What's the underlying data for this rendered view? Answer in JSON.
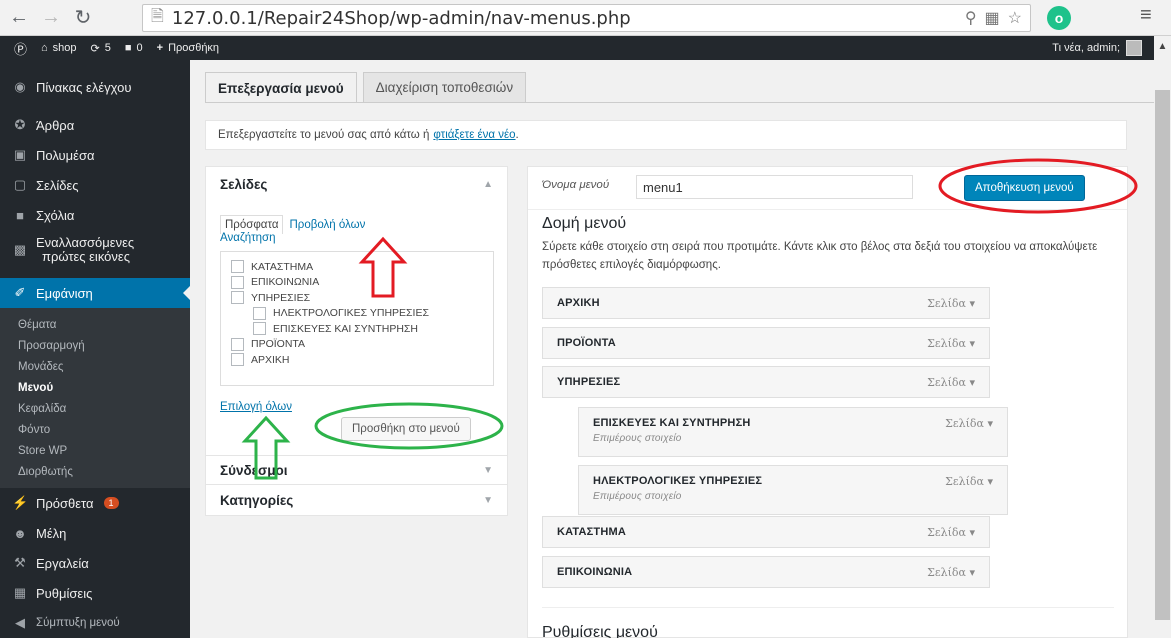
{
  "browser": {
    "url": "127.0.0.1/Repair24Shop/wp-admin/nav-menus.php"
  },
  "adminbar": {
    "site": "shop",
    "updates": "5",
    "comments": "0",
    "new_label": "Προσθήκη",
    "greeting": "Τι νέα, admin;"
  },
  "sidebar": {
    "items": [
      {
        "label": "Πίνακας ελέγχου",
        "icon": "dashboard-icon"
      },
      {
        "label": "Άρθρα",
        "icon": "pin-icon"
      },
      {
        "label": "Πολυμέσα",
        "icon": "media-icon"
      },
      {
        "label": "Σελίδες",
        "icon": "page-icon"
      },
      {
        "label": "Σχόλια",
        "icon": "comment-icon"
      },
      {
        "label_line1": "Εναλλασσόμενες",
        "label_line2": "πρώτες εικόνες",
        "icon": "slides-icon"
      },
      {
        "label": "Εμφάνιση",
        "icon": "brush-icon"
      }
    ],
    "submenu": [
      "Θέματα",
      "Προσαρμογή",
      "Μονάδες",
      "Μενού",
      "Κεφαλίδα",
      "Φόντο",
      "Store WP",
      "Διορθωτής"
    ],
    "items2": [
      {
        "label": "Πρόσθετα",
        "badge": "1",
        "icon": "plugin-icon"
      },
      {
        "label": "Μέλη",
        "icon": "users-icon"
      },
      {
        "label": "Εργαλεία",
        "icon": "tools-icon"
      },
      {
        "label": "Ρυθμίσεις",
        "icon": "settings-icon"
      },
      {
        "label": "Σύμπτυξη μενού",
        "icon": "collapse-icon"
      }
    ]
  },
  "tabs": {
    "edit": "Επεξεργασία μενού",
    "locations": "Διαχείριση τοποθεσιών"
  },
  "notice": {
    "text": "Επεξεργαστείτε το μενού σας από κάτω ή",
    "link": "φτιάξετε ένα νέο",
    "end": "."
  },
  "pages_box": {
    "title": "Σελίδες",
    "tab_recent": "Πρόσφατα",
    "tab_all": "Προβολή όλων",
    "tab_search": "Αναζήτηση",
    "items": [
      "ΚΑΤΑΣΤΗΜΑ",
      "ΕΠΙΚΟΙΝΩΝΙΑ",
      "ΥΠΗΡΕΣΙΕΣ",
      "ΗΛΕΚΤΡΟΛΟΓΙΚΕΣ ΥΠΗΡΕΣΙΕΣ",
      "ΕΠΙΣΚΕΥΕΣ ΚΑΙ ΣΥΝΤΗΡΗΣΗ",
      "ΠΡΟΪΟΝΤΑ",
      "ΑΡΧΙΚΗ"
    ],
    "select_all": "Επιλογή όλων",
    "add_button": "Προσθήκη στο μενού"
  },
  "links_box": {
    "title": "Σύνδεσμοι"
  },
  "cat_box": {
    "title": "Κατηγορίες"
  },
  "menu": {
    "name_label": "Όνομα μενού",
    "name_value": "menu1",
    "save_button": "Αποθήκευση μενού",
    "structure_title": "Δομή μενού",
    "structure_desc": "Σύρετε κάθε στοιχείο στη σειρά που προτιμάτε. Κάντε κλικ στο βέλος στα δεξιά του στοιχείου να αποκαλύψετε πρόσθετες επιλογές διαμόρφωσης.",
    "type_label": "Σελίδα",
    "sub_label": "Επιμέρους στοιχείο",
    "items": [
      "ΑΡΧΙΚΗ",
      "ΠΡΟΪΟΝΤΑ",
      "ΥΠΗΡΕΣΙΕΣ",
      "ΕΠΙΣΚΕΥΕΣ ΚΑΙ ΣΥΝΤΗΡΗΣΗ",
      "ΗΛΕΚΤΡΟΛΟΓΙΚΕΣ ΥΠΗΡΕΣΙΕΣ",
      "ΚΑΤΑΣΤΗΜΑ",
      "ΕΠΙΚΟΙΝΩΝΙΑ"
    ],
    "settings_title": "Ρυθμίσεις μενού"
  },
  "colors": {
    "accent": "#0073aa",
    "sidebar_bg": "#23282d",
    "annotation_red": "#e31b23",
    "annotation_green": "#2db34a"
  }
}
